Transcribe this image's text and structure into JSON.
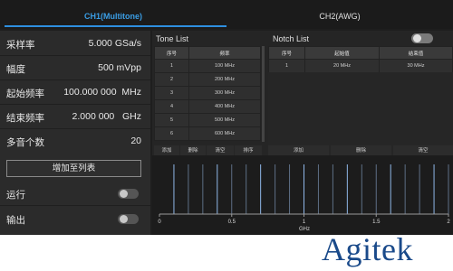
{
  "tabs": [
    {
      "label": "CH1(Multitone)",
      "active": true
    },
    {
      "label": "CH2(AWG)",
      "active": false
    }
  ],
  "left_panel": {
    "params": [
      {
        "label": "采样率",
        "value": "5.000 GSa/s"
      },
      {
        "label": "幅度",
        "value": "500 mVpp"
      },
      {
        "label": "起始频率",
        "value": "100.000 000  MHz"
      },
      {
        "label": "结束频率",
        "value": "2.000 000   GHz"
      },
      {
        "label": "多音个数",
        "value": "20"
      }
    ],
    "add_button": "增加至列表",
    "run_label": "运行",
    "output_label": "输出",
    "run_on": false,
    "output_on": false
  },
  "tone_list": {
    "title": "Tone List",
    "headers": [
      "序号",
      "频率"
    ],
    "rows": [
      [
        "1",
        "100 MHz"
      ],
      [
        "2",
        "200 MHz"
      ],
      [
        "3",
        "300 MHz"
      ],
      [
        "4",
        "400 MHz"
      ],
      [
        "5",
        "500 MHz"
      ],
      [
        "6",
        "600 MHz"
      ]
    ],
    "actions": [
      "添加",
      "删除",
      "清空",
      "排序"
    ]
  },
  "notch_list": {
    "title": "Notch List",
    "enabled": false,
    "headers": [
      "序号",
      "起始值",
      "结束值"
    ],
    "rows": [
      [
        "1",
        "20 MHz",
        "30 MHz"
      ]
    ],
    "actions": [
      "添加",
      "删除",
      "清空"
    ]
  },
  "chart_data": {
    "type": "bar",
    "xlabel": "GHz",
    "xlim": [
      0,
      2
    ],
    "x_ticks": [
      "0",
      "0.5",
      "1",
      "1.5",
      "2"
    ],
    "x": [
      0.1,
      0.2,
      0.3,
      0.4,
      0.5,
      0.6,
      0.7,
      0.8,
      0.9,
      1.0,
      1.1,
      1.2,
      1.3,
      1.4,
      1.5,
      1.6,
      1.7,
      1.8,
      1.9,
      2.0
    ],
    "values": [
      1,
      1,
      1,
      1,
      1,
      1,
      1,
      1,
      1,
      1,
      1,
      1,
      1,
      1,
      1,
      1,
      1,
      1,
      1,
      1
    ],
    "grid": false
  },
  "colors": {
    "accent": "#2e8fe0",
    "line_bright": "#8fb7e8",
    "line_dim": "#5e6f86"
  },
  "brand": "Agitek"
}
